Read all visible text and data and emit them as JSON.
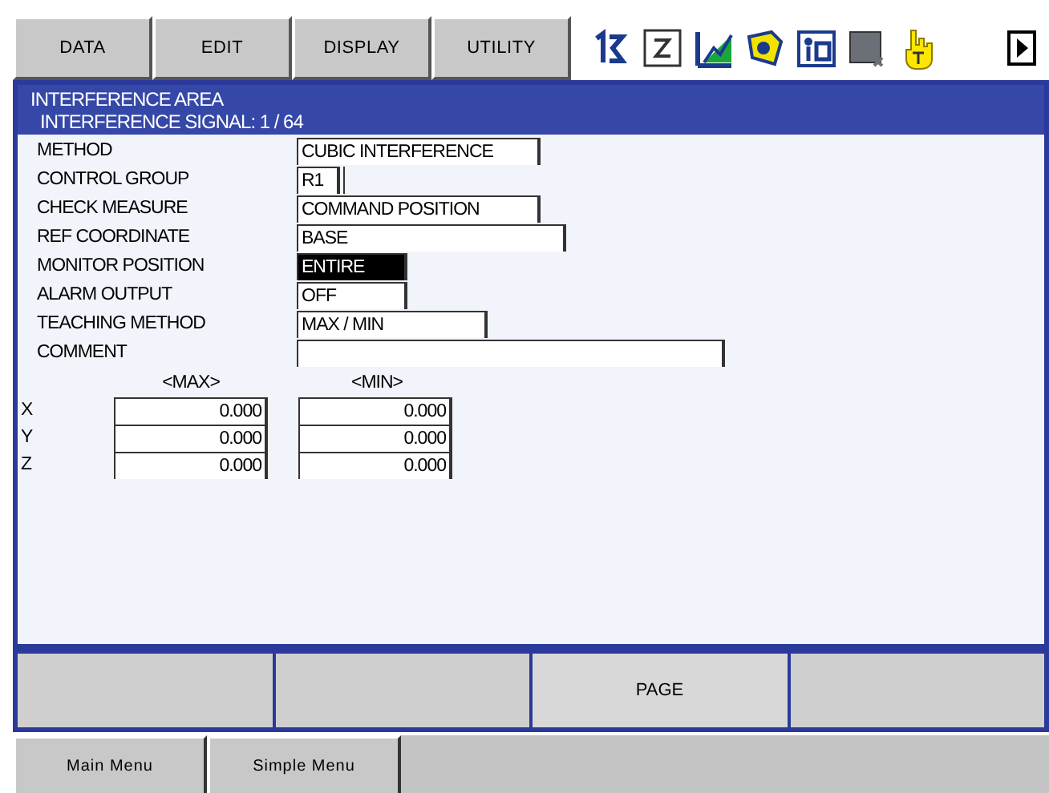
{
  "menu_tabs": [
    {
      "label": "DATA"
    },
    {
      "label": "EDIT"
    },
    {
      "label": "DISPLAY"
    },
    {
      "label": "UTILITY"
    }
  ],
  "title": "INTERFERENCE AREA",
  "subtitle": "INTERFERENCE SIGNAL: 1 / 64",
  "fields": [
    {
      "label": "METHOD",
      "value": "CUBIC INTERFERENCE",
      "selected": false
    },
    {
      "label": "CONTROL GROUP",
      "value": "R1",
      "selected": false,
      "extra_box": true
    },
    {
      "label": "CHECK MEASURE",
      "value": "COMMAND POSITION",
      "selected": false
    },
    {
      "label": "REF COORDINATE",
      "value": "BASE",
      "selected": false
    },
    {
      "label": "MONITOR POSITION",
      "value": "ENTIRE",
      "selected": true
    },
    {
      "label": "ALARM OUTPUT",
      "value": "OFF",
      "selected": false
    },
    {
      "label": "TEACHING METHOD",
      "value": "MAX / MIN",
      "selected": false
    },
    {
      "label": "COMMENT",
      "selected": false
    }
  ],
  "column_headers": [
    "<MAX>",
    "<MIN>"
  ],
  "axes": [
    {
      "axis": "X",
      "max": "0.000",
      "min": "0.000"
    },
    {
      "axis": "Y",
      "max": "0.000",
      "min": "0.000"
    },
    {
      "axis": "Z",
      "max": "0.000",
      "min": "0.000"
    }
  ],
  "function_keys": [
    {
      "kind": "blank"
    },
    {
      "kind": "blank"
    },
    {
      "kind": "labeled",
      "label": "PAGE"
    },
    {
      "kind": "blank"
    }
  ],
  "bottom_tabs": [
    {
      "label": "Main Menu"
    },
    {
      "label": "Simple Menu"
    }
  ]
}
